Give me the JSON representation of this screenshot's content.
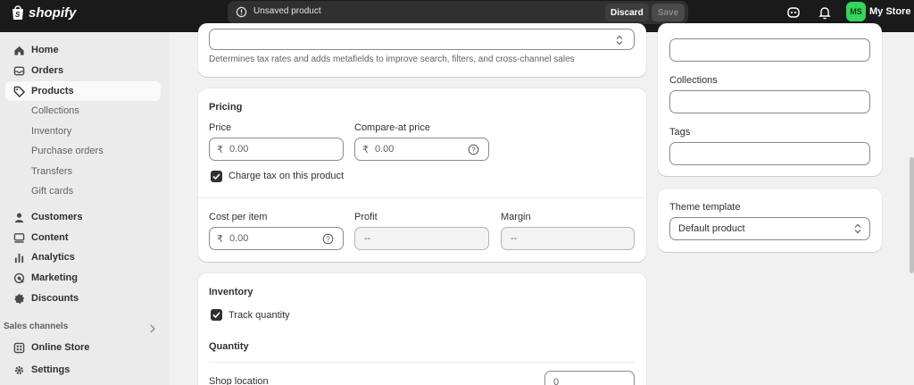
{
  "app": {
    "logo_text": "shopify"
  },
  "topbar": {
    "unsaved_text": "Unsaved product",
    "discard_label": "Discard",
    "save_label": "Save",
    "avatar_initials": "MS",
    "store_name": "My Store",
    "brand_color": "#36d35a"
  },
  "sidebar": {
    "items": [
      {
        "label": "Home",
        "icon": "home-icon"
      },
      {
        "label": "Orders",
        "icon": "inbox-icon"
      },
      {
        "label": "Products",
        "icon": "tag-icon",
        "active": true
      },
      {
        "label": "Customers",
        "icon": "person-icon"
      },
      {
        "label": "Content",
        "icon": "content-icon"
      },
      {
        "label": "Analytics",
        "icon": "bar-chart-icon"
      },
      {
        "label": "Marketing",
        "icon": "target-icon"
      },
      {
        "label": "Discounts",
        "icon": "discount-icon"
      }
    ],
    "sub_items": [
      "Collections",
      "Inventory",
      "Purchase orders",
      "Transfers",
      "Gift cards"
    ],
    "sales_channels_label": "Sales channels",
    "online_store_label": "Online Store",
    "settings_label": "Settings"
  },
  "category": {
    "help_text": "Determines tax rates and adds metafields to improve search, filters, and cross-channel sales"
  },
  "pricing": {
    "title": "Pricing",
    "price_label": "Price",
    "price_value": "0.00",
    "compare_label": "Compare-at price",
    "compare_value": "0.00",
    "currency_symbol": "₹",
    "charge_tax_label": "Charge tax on this product",
    "charge_tax_checked": true,
    "cost_label": "Cost per item",
    "cost_value": "0.00",
    "profit_label": "Profit",
    "profit_value": "--",
    "margin_label": "Margin",
    "margin_value": "--"
  },
  "inventory": {
    "title": "Inventory",
    "track_label": "Track quantity",
    "track_checked": true,
    "quantity_title": "Quantity",
    "location_label": "Shop location",
    "location_qty": "0"
  },
  "organization": {
    "collections_label": "Collections",
    "tags_label": "Tags"
  },
  "theme": {
    "title": "Theme template",
    "selected": "Default product"
  }
}
